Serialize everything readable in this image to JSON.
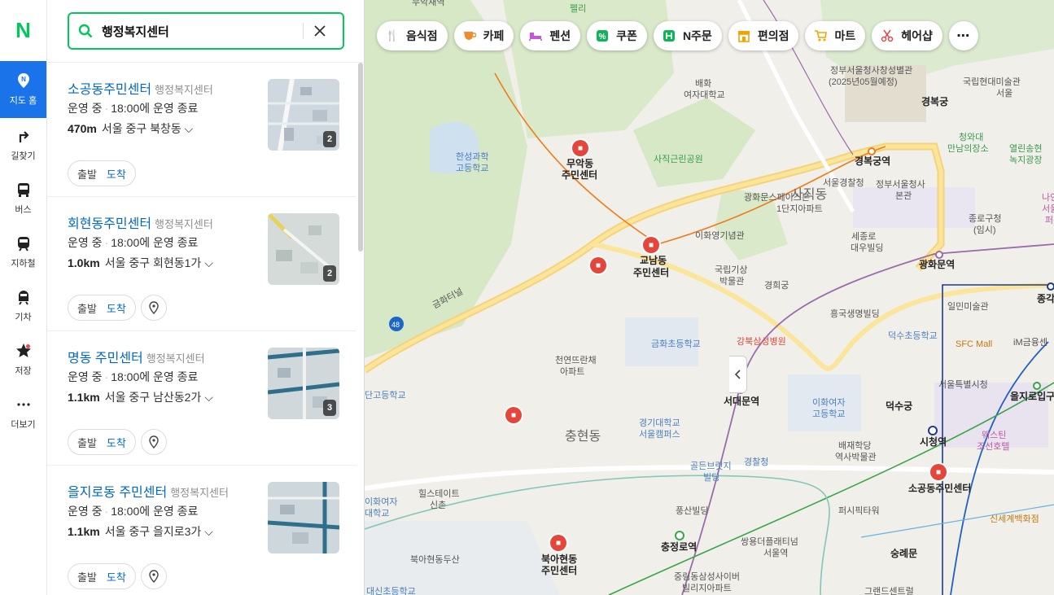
{
  "brand": {
    "logo": "N",
    "color": "#03c75a"
  },
  "rail": {
    "items": [
      {
        "label": "지도 홈",
        "icon": "map-home-icon",
        "active": true
      },
      {
        "label": "길찾기",
        "icon": "directions-icon"
      },
      {
        "label": "버스",
        "icon": "bus-icon"
      },
      {
        "label": "지하철",
        "icon": "subway-icon"
      },
      {
        "label": "기차",
        "icon": "train-icon"
      },
      {
        "label": "저장",
        "icon": "star-icon"
      },
      {
        "label": "더보기",
        "icon": "more-icon"
      }
    ]
  },
  "search": {
    "value": "행정복지센터"
  },
  "results": [
    {
      "name": "소공동주민센터",
      "category": "행정복지센터",
      "status": "운영 중",
      "hours": "18:00에 운영 종료",
      "distance": "470m",
      "address": "서울 중구 북창동",
      "photo_count": "2",
      "depart": "출발",
      "arrive": "도착"
    },
    {
      "name": "회현동주민센터",
      "category": "행정복지센터",
      "status": "운영 중",
      "hours": "18:00에 운영 종료",
      "distance": "1.0km",
      "address": "서울 중구 회현동1가",
      "photo_count": "2",
      "depart": "출발",
      "arrive": "도착"
    },
    {
      "name": "명동 주민센터",
      "category": "행정복지센터",
      "status": "운영 중",
      "hours": "18:00에 운영 종료",
      "distance": "1.1km",
      "address": "서울 중구 남산동2가",
      "photo_count": "3",
      "depart": "출발",
      "arrive": "도착"
    },
    {
      "name": "을지로동 주민센터",
      "category": "행정복지센터",
      "status": "운영 중",
      "hours": "18:00에 운영 종료",
      "distance": "1.1km",
      "address": "서울 중구 을지로3가",
      "photo_count": "",
      "depart": "출발",
      "arrive": "도착"
    }
  ],
  "chips": [
    {
      "label": "음식점",
      "icon": "restaurant-icon",
      "color": "#f27b1d"
    },
    {
      "label": "카페",
      "icon": "cafe-icon",
      "color": "#f28a2e"
    },
    {
      "label": "펜션",
      "icon": "pension-icon",
      "color": "#c558d6"
    },
    {
      "label": "쿠폰",
      "icon": "coupon-icon",
      "color": "#12b25a"
    },
    {
      "label": "N주문",
      "icon": "order-icon",
      "color": "#12b25a"
    },
    {
      "label": "편의점",
      "icon": "store-icon",
      "color": "#f5a300"
    },
    {
      "label": "마트",
      "icon": "cart-icon",
      "color": "#f5a300"
    },
    {
      "label": "헤어샵",
      "icon": "scissors-icon",
      "color": "#e0484f"
    }
  ],
  "map": {
    "labels": [
      "무악재역",
      "펠리",
      "무궁화",
      "정부서울청사창성별관",
      "(2025년05월예정)",
      "국립현대미술관",
      "서울",
      "배화",
      "여자대학교",
      "경복궁",
      "청와대",
      "만남의장소",
      "열린송현",
      "녹지광장",
      "한성과학",
      "고등학교",
      "무악동",
      "주민센터",
      "사직근린공원",
      "경복궁역",
      "서울경찰청",
      "정부서울청사",
      "본관",
      "광화문스페이스본",
      "1단지아파트",
      "사직동",
      "종로구청",
      "(임시)",
      "이화영기념관",
      "세종로",
      "대우빌딩",
      "광화문역",
      "교남동",
      "국립기상",
      "박물관",
      "경희궁",
      "일민미술관",
      "금화터널",
      "흥국생명빌딩",
      "덕수초등학교",
      "SFC Mall",
      "iM금융센",
      "강북삼성병원",
      "금화초등학교",
      "천연뜨란채",
      "아파트",
      "서울특별시청",
      "을지로입구",
      "서대문역",
      "이화여자",
      "고등학교",
      "덕수궁",
      "단고등학교",
      "충현동",
      "경기대학교",
      "서울캠퍼스",
      "시청역",
      "웨스틴",
      "조선호텔",
      "배재학당",
      "역사박물관",
      "골든브릿지",
      "빌딩",
      "경찰청",
      "소공동주민센터",
      "힐스테이트",
      "신촌",
      "풍산빌딩",
      "퍼시픽타워",
      "신세계백화점",
      "충정로역",
      "쌍용더플래티넘",
      "서울역",
      "숭례문",
      "북아현동두산",
      "북아현동",
      "중림동삼성사이버",
      "빌리지아파트",
      "그랜드센트럴",
      "이화여자",
      "대학교",
      "대신초등학교",
      "종각",
      "무악재역",
      "48",
      "나인",
      "서울",
      "퍼"
    ]
  }
}
